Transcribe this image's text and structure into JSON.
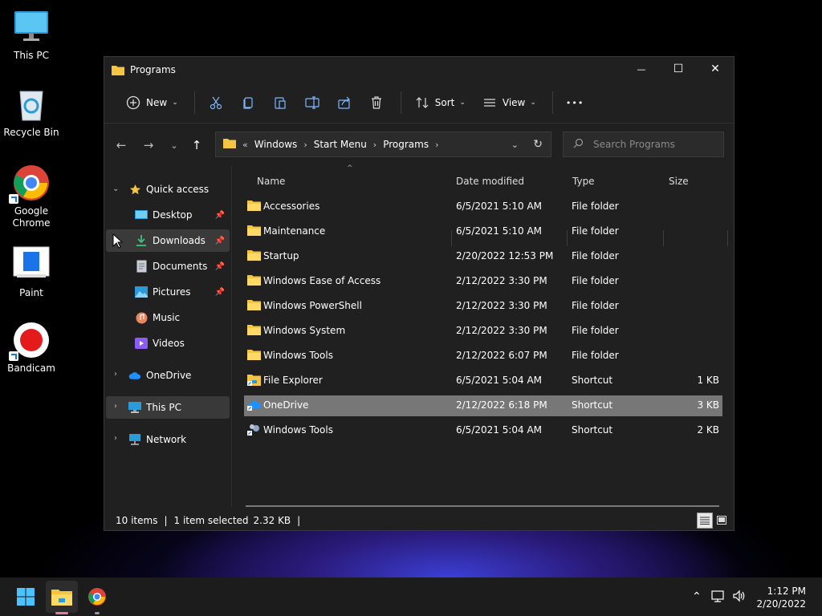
{
  "desktop": {
    "icons": [
      {
        "label": "This PC"
      },
      {
        "label": "Recycle Bin"
      },
      {
        "label": "Google Chrome"
      },
      {
        "label": "Paint"
      },
      {
        "label": "Bandicam"
      }
    ]
  },
  "window": {
    "title": "Programs",
    "controls": {
      "minimize": "—",
      "maximize": "☐",
      "close": "✕"
    }
  },
  "toolbar": {
    "new_label": "New",
    "sort_label": "Sort",
    "view_label": "View",
    "more_label": "•••"
  },
  "address": {
    "overflow": "«",
    "crumbs": [
      "Windows",
      "Start Menu",
      "Programs"
    ]
  },
  "search": {
    "placeholder": "Search Programs"
  },
  "nav": {
    "quick_access": "Quick access",
    "items": [
      {
        "label": "Desktop",
        "pinned": true
      },
      {
        "label": "Downloads",
        "pinned": true
      },
      {
        "label": "Documents",
        "pinned": true
      },
      {
        "label": "Pictures",
        "pinned": true
      },
      {
        "label": "Music",
        "pinned": false
      },
      {
        "label": "Videos",
        "pinned": false
      }
    ],
    "onedrive": "OneDrive",
    "this_pc": "This PC",
    "network": "Network"
  },
  "columns": {
    "name": "Name",
    "date": "Date modified",
    "type": "Type",
    "size": "Size"
  },
  "files": [
    {
      "name": "Accessories",
      "date": "6/5/2021 5:10 AM",
      "type": "File folder",
      "size": "",
      "kind": "folder"
    },
    {
      "name": "Maintenance",
      "date": "6/5/2021 5:10 AM",
      "type": "File folder",
      "size": "",
      "kind": "folder"
    },
    {
      "name": "Startup",
      "date": "2/20/2022 12:53 PM",
      "type": "File folder",
      "size": "",
      "kind": "folder"
    },
    {
      "name": "Windows Ease of Access",
      "date": "2/12/2022 3:30 PM",
      "type": "File folder",
      "size": "",
      "kind": "folder"
    },
    {
      "name": "Windows PowerShell",
      "date": "2/12/2022 3:30 PM",
      "type": "File folder",
      "size": "",
      "kind": "folder"
    },
    {
      "name": "Windows System",
      "date": "2/12/2022 3:30 PM",
      "type": "File folder",
      "size": "",
      "kind": "folder"
    },
    {
      "name": "Windows Tools",
      "date": "2/12/2022 6:07 PM",
      "type": "File folder",
      "size": "",
      "kind": "folder"
    },
    {
      "name": "File Explorer",
      "date": "6/5/2021 5:04 AM",
      "type": "Shortcut",
      "size": "1 KB",
      "kind": "shortcut-explorer"
    },
    {
      "name": "OneDrive",
      "date": "2/12/2022 6:18 PM",
      "type": "Shortcut",
      "size": "3 KB",
      "kind": "shortcut-onedrive",
      "selected": true
    },
    {
      "name": "Windows Tools",
      "date": "6/5/2021 5:04 AM",
      "type": "Shortcut",
      "size": "2 KB",
      "kind": "shortcut-tools"
    }
  ],
  "status": {
    "count": "10 items",
    "selection": "1 item selected",
    "size": "2.32 KB"
  },
  "clock": {
    "time": "1:12 PM",
    "date": "2/20/2022"
  },
  "colors": {
    "folder": "#f4c542",
    "selection": "#777777",
    "accent": "#0078d4"
  }
}
